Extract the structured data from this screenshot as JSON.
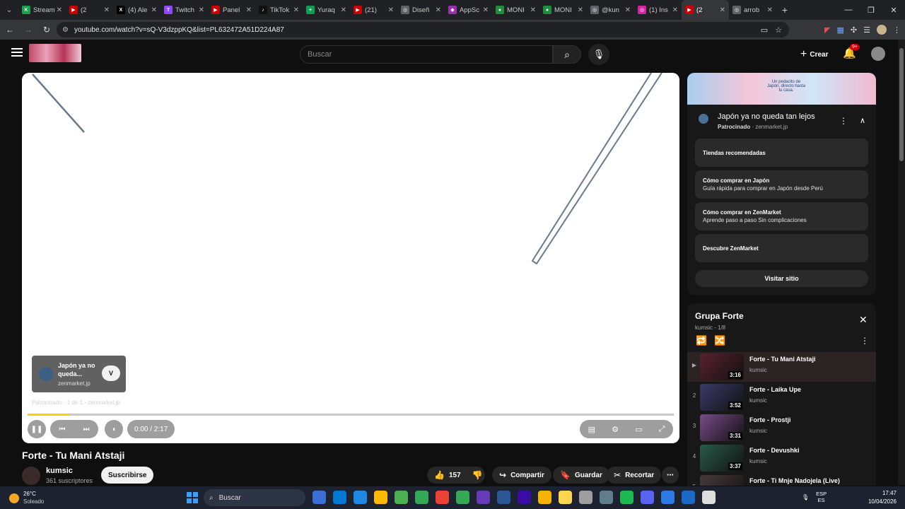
{
  "browser": {
    "tabs": [
      {
        "title": "Stream",
        "color": "#1aa34a",
        "glyph": "K",
        "active": false
      },
      {
        "title": "(2",
        "color": "#cc0000",
        "glyph": "▶",
        "active": false
      },
      {
        "title": "(4) Ale",
        "color": "#000000",
        "glyph": "X",
        "active": false
      },
      {
        "title": "Twitch",
        "color": "#9146ff",
        "glyph": "T",
        "active": false
      },
      {
        "title": "Panel",
        "color": "#cc0000",
        "glyph": "▶",
        "active": false
      },
      {
        "title": "TikTok",
        "color": "#111111",
        "glyph": "♪",
        "active": false
      },
      {
        "title": "Yuraq",
        "color": "#0f9d58",
        "glyph": "+",
        "active": false
      },
      {
        "title": "(21)",
        "color": "#cc0000",
        "glyph": "▶",
        "active": false
      },
      {
        "title": "Diseñ",
        "color": "#5f6368",
        "glyph": "◎",
        "active": false
      },
      {
        "title": "AppSc",
        "color": "#9b2fae",
        "glyph": "◆",
        "active": false
      },
      {
        "title": "MONI",
        "color": "#1e8e3e",
        "glyph": "●",
        "active": false
      },
      {
        "title": "MONI",
        "color": "#1e8e3e",
        "glyph": "●",
        "active": false
      },
      {
        "title": "@kun",
        "color": "#5f6368",
        "glyph": "◎",
        "active": false
      },
      {
        "title": "(1) Ins",
        "color": "#d6249f",
        "glyph": "◎",
        "active": false
      },
      {
        "title": "(2",
        "color": "#cc0000",
        "glyph": "▶",
        "active": true
      },
      {
        "title": "arrob",
        "color": "#5f6368",
        "glyph": "◎",
        "active": false
      }
    ],
    "url": "youtube.com/watch?v=sQ-V3dzppKQ&list=PL632472A51D224A87"
  },
  "youtube": {
    "search_placeholder": "Buscar",
    "create_label": "Crear",
    "notif_badge": "9+"
  },
  "player": {
    "ad_card": {
      "title": "Japón ya no queda...",
      "domain": "zenmarket.jp",
      "visit_letter": "V"
    },
    "ad_info": "Patrocinado · 1 de 1 · zenmarket.jp",
    "progress_fraction": 0.065,
    "time": "0:00 / 2:17"
  },
  "video": {
    "title": "Forte - Tu Mani Atstaji",
    "channel": "kumsic",
    "subscribers": "361 suscriptores",
    "subscribe_label": "Suscribirse",
    "likes": "157",
    "share_label": "Compartir",
    "save_label": "Guardar",
    "clip_label": "Recortar"
  },
  "ad_panel": {
    "banner_text": "Un pedacito de Japón, directo hasta tu casa.",
    "title": "Japón ya no queda tan lejos",
    "sponsored": "Patrocinado",
    "domain": "· zenmarket.jp",
    "links": [
      {
        "line1": "Tiendas recomendadas",
        "line2": ""
      },
      {
        "line1": "Cómo comprar en Japón",
        "line2": "Guía rápida para comprar en Japón desde Perú"
      },
      {
        "line1": "Cómo comprar en ZenMarket",
        "line2": "Aprende paso a paso Sin complicaciones"
      },
      {
        "line1": "Descubre ZenMarket",
        "line2": ""
      }
    ],
    "visit_label": "Visitar sitio"
  },
  "playlist": {
    "title": "Grupa Forte",
    "subtitle": "kumsic - 1/8",
    "items": [
      {
        "index": "▶",
        "title": "Forte - Tu Mani Atstaji",
        "channel": "kumsic",
        "duration": "3:16",
        "active": true,
        "thumb": "#5a2030"
      },
      {
        "index": "2",
        "title": "Forte - Laika Upe",
        "channel": "kumsic",
        "duration": "3:52",
        "active": false,
        "thumb": "#3a3a6a"
      },
      {
        "index": "3",
        "title": "Forte - Prostji",
        "channel": "kumsic",
        "duration": "3:31",
        "active": false,
        "thumb": "#7a4a8a"
      },
      {
        "index": "4",
        "title": "Forte - Devushki",
        "channel": "kumsic",
        "duration": "3:37",
        "active": false,
        "thumb": "#2a5a4a"
      },
      {
        "index": "5",
        "title": "Forte - Ti Mnje Nadojela (Live)",
        "channel": "",
        "duration": "",
        "active": false,
        "thumb": "#4a3a3a"
      }
    ]
  },
  "taskbar": {
    "temperature": "26°C",
    "weather": "Soleado",
    "search_label": "Buscar",
    "lang1": "ESP",
    "lang2": "ES",
    "time": "17:47",
    "date": "10/04/2026",
    "icons": [
      "#3a6fd8",
      "#0078d4",
      "#1e88e5",
      "#ffb900",
      "#4caf50",
      "#34a853",
      "#ea4335",
      "#34a853",
      "#673ab7",
      "#2b5797",
      "#3a0ca3",
      "#f5b400",
      "#ffd54f",
      "#9e9e9e",
      "#607d8b",
      "#1db954",
      "#5865f2",
      "#2c7be5",
      "#1b6ac9",
      "#dddddd"
    ]
  }
}
